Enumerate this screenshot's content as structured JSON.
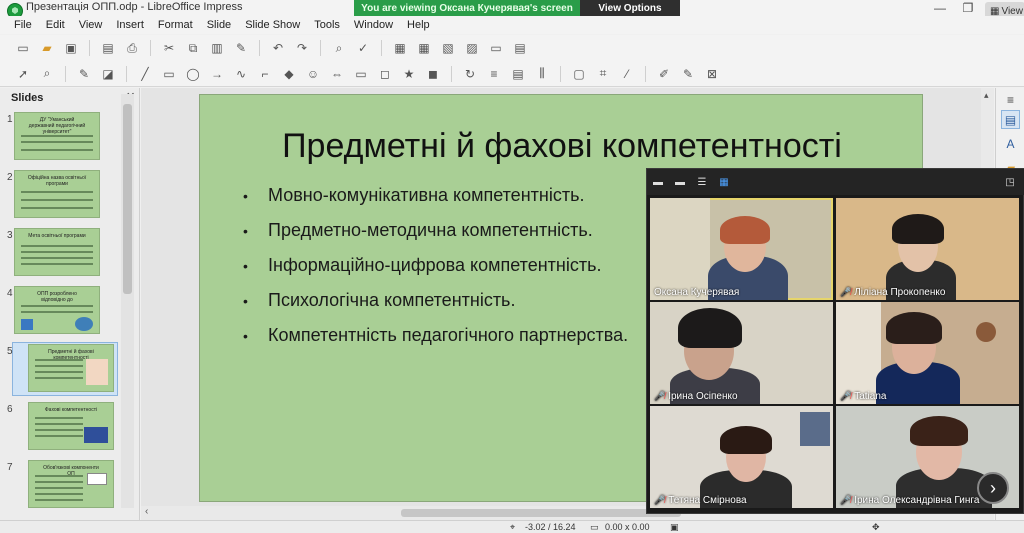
{
  "window": {
    "title": "Презентація ОПП.odp - LibreOffice Impress",
    "banner_message": "You are viewing Оксана Кучерявая's screen",
    "view_options": "View Options",
    "view_label": "View"
  },
  "menu": [
    "File",
    "Edit",
    "View",
    "Insert",
    "Format",
    "Slide",
    "Slide Show",
    "Tools",
    "Window",
    "Help"
  ],
  "slides_panel": {
    "header": "Slides",
    "close": "✕",
    "slides": [
      {
        "number": "1",
        "caption": "ДУ \"Уманський державний педагогічний університет\""
      },
      {
        "number": "2",
        "caption": "Офіційна назва освітньої програми"
      },
      {
        "number": "3",
        "caption": "Мета освітньої програми"
      },
      {
        "number": "4",
        "caption": "ОПП розроблено відповідно до"
      },
      {
        "number": "5",
        "caption": "Предметні й фахові компетентності"
      },
      {
        "number": "6",
        "caption": "Фахові компетентності"
      },
      {
        "number": "7",
        "caption": "Обов'язкові компоненти ОП"
      }
    ],
    "selected_slide": 5
  },
  "slide": {
    "title": "Предметні й фахові компетентності",
    "bullets": [
      "Мовно-комунікативна компетентність.",
      "Предметно-методична компетентність.",
      "Інформаційно-цифрова компетентність.",
      "Психологічна компетентність.",
      "Компетентність педагогічного партнерства."
    ],
    "bullet_symbol": "•"
  },
  "status": {
    "position": "-3.02 / 16.24",
    "size": "0.00 x 0.00"
  },
  "zoom": {
    "participants": [
      {
        "name": "Оксана Кучерявая",
        "muted": false,
        "active": true
      },
      {
        "name": "Ліліана Прокопенко",
        "muted": true,
        "active": false
      },
      {
        "name": "Ірина Осіпенко",
        "muted": true,
        "active": false
      },
      {
        "name": "Tatiana",
        "muted": true,
        "active": false
      },
      {
        "name": "Тетяна Смірнова",
        "muted": true,
        "active": false
      },
      {
        "name": "Ірина Олександрівна Гинга",
        "muted": true,
        "active": false
      }
    ],
    "next_page": "›"
  },
  "colors": {
    "slide_bg": "#a9cf95",
    "banner_green": "#2a9d49",
    "active_speaker": "#e6d56b"
  }
}
